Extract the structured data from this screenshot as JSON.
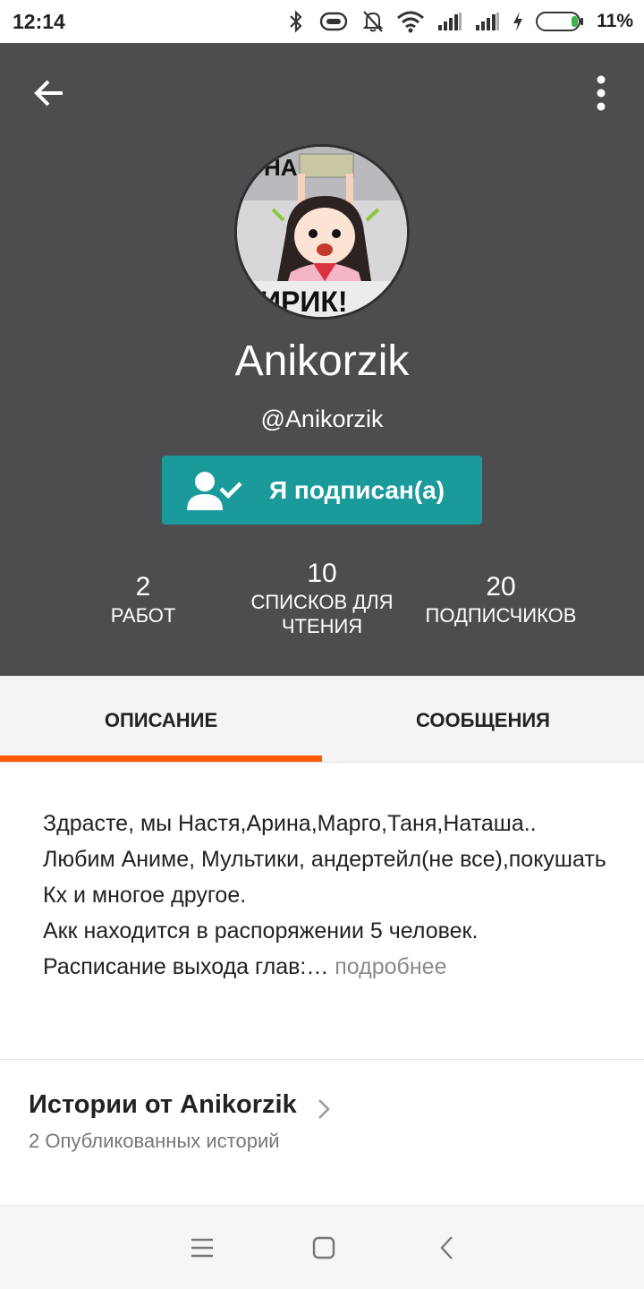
{
  "status_bar": {
    "time": "12:14",
    "battery_percent": "11%",
    "icons": [
      "bluetooth-icon",
      "vibrate-icon",
      "mute-icon",
      "wifi-icon",
      "signal-icon",
      "signal-icon",
      "charging-icon",
      "battery-icon"
    ]
  },
  "header": {
    "back_icon": "arrow-left-icon",
    "menu_icon": "more-vertical-icon",
    "avatar_icon": "avatar",
    "name": "Anikorzik",
    "handle": "@Anikorzik",
    "follow_button_label": "Я подписан(а)",
    "follow_button_icon": "person-check-icon",
    "colors": {
      "background": "#4d4d4f",
      "button": "#1a9a9a",
      "accent": "#ff5a00"
    }
  },
  "stats": {
    "works": {
      "count": "2",
      "label": "РАБОТ"
    },
    "reading_lists": {
      "count": "10",
      "label": "СПИСКОВ ДЛЯ ЧТЕНИЯ"
    },
    "followers": {
      "count": "20",
      "label": "ПОДПИСЧИКОВ"
    }
  },
  "tabs": {
    "items": [
      {
        "label": "ОПИСАНИЕ",
        "active": true
      },
      {
        "label": "СООБЩЕНИЯ",
        "active": false
      }
    ]
  },
  "description": {
    "text": "Здрасте, мы Настя,Арина,Марго,Таня,Наташа..\nЛюбим Аниме, Мультики, андертейл(не все),покушать Кх и многое другое.\nАкк находится в распоряжении 5 человек.\nРасписание выхода глав:…",
    "more_label": " подробнее"
  },
  "stories": {
    "title": "Истории от Anikorzik",
    "subtitle": "2 Опубликованных историй"
  },
  "nav_bar": {
    "items": [
      "menu-icon",
      "home-square-icon",
      "back-chevron-icon"
    ]
  }
}
